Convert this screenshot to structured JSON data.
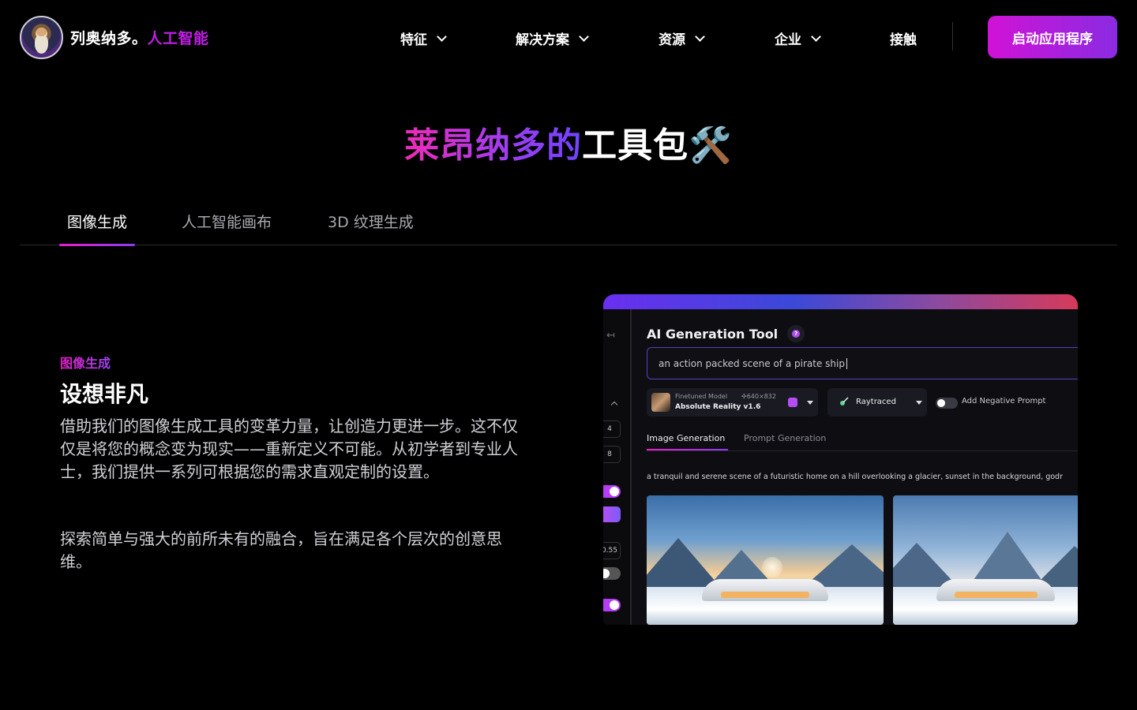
{
  "nav": {
    "brand_primary": "列奥纳多。",
    "brand_accent": "人工智能",
    "items": [
      {
        "label": "特征"
      },
      {
        "label": "解决方案"
      },
      {
        "label": "资源"
      },
      {
        "label": "企业"
      },
      {
        "label": "接触"
      }
    ],
    "cta_label": "启动应用程序"
  },
  "hero": {
    "title_gradient": "莱昂纳多的",
    "title_plain": "工具包🛠️"
  },
  "tabs": [
    {
      "label": "图像生成",
      "active": true
    },
    {
      "label": "人工智能画布",
      "active": false
    },
    {
      "label": "3D 纹理生成",
      "active": false
    }
  ],
  "feature": {
    "eyebrow": "图像生成",
    "headline": "设想非凡",
    "paragraph1": "借助我们的图像生成工具的变革力量，让创造力更进一步。这不仅仅是将您的概念变为现实——重新定义不可能。从初学者到专业人士，我们提供一系列可根据您的需求直观定制的设置。",
    "paragraph2": "探索简单与强大的前所未有的融合，旨在满足各个层次的创意思维。"
  },
  "preview": {
    "title": "AI Generation Tool",
    "help_glyph": "?",
    "prompt_value": "an action packed scene of a pirate ship",
    "collapse_glyph": "↤",
    "model_label": "Finetuned Model",
    "model_dims": "✣640×832",
    "model_name": "Absolute Reality v1.6",
    "style_name": "Raytraced",
    "negative_prompt_label": "Add Negative Prompt",
    "subtabs": [
      {
        "label": "Image Generation",
        "active": true
      },
      {
        "label": "Prompt Generation",
        "active": false
      }
    ],
    "generated_prompt": "a tranquil and serene scene of a futuristic home on a hill overlooking a glacier, sunset in the background, godr",
    "side_values": [
      "4",
      "8",
      "0.55"
    ]
  },
  "colors": {
    "accent_pink": "#d112d6",
    "accent_purple": "#8a2be2",
    "background": "#000000"
  }
}
